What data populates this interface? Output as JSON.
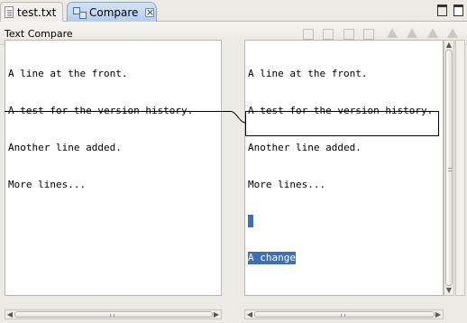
{
  "tabs": [
    {
      "label": "test.txt",
      "icon": "text-file-icon",
      "active": false
    },
    {
      "label": "Compare",
      "icon": "compare-icon",
      "active": true
    }
  ],
  "compare": {
    "title": "Text Compare",
    "toolbar": [
      {
        "icon": "copy-all-left-to-right-icon"
      },
      {
        "icon": "copy-all-right-to-left-icon"
      },
      {
        "icon": "copy-current-change-left-to-right-icon"
      },
      {
        "icon": "copy-current-change-right-to-left-icon"
      },
      {
        "icon": "next-difference-icon"
      },
      {
        "icon": "previous-difference-icon"
      },
      {
        "icon": "next-change-icon"
      },
      {
        "icon": "previous-change-icon"
      }
    ],
    "left_lines": [
      "A line at the front.",
      "A test for the version history.",
      "Another line added.",
      "More lines..."
    ],
    "right_lines": [
      "A line at the front.",
      "A test for the version history.",
      "Another line added.",
      "More lines...",
      "",
      "A change"
    ],
    "selected_text": "A change",
    "selection_color": "#3d6fb6",
    "diff_border_color": "#000000"
  }
}
